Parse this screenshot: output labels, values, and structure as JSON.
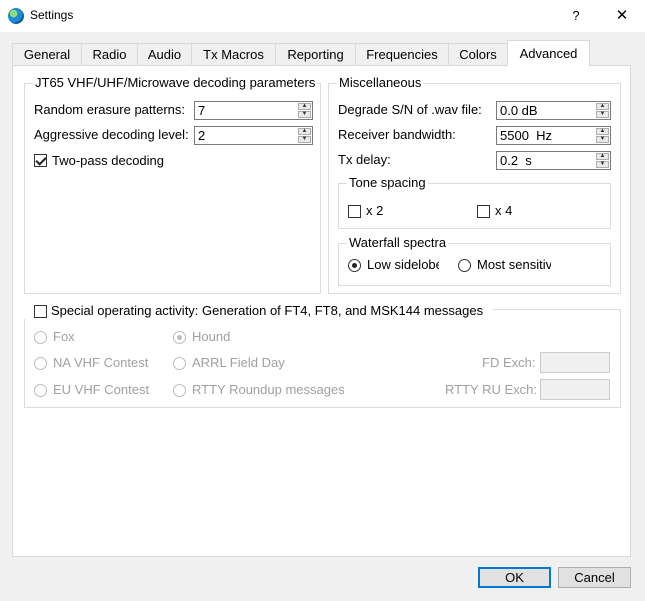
{
  "window": {
    "title": "Settings",
    "help_glyph": "?",
    "close_glyph": "✕"
  },
  "tabs": [
    {
      "label": "General"
    },
    {
      "label": "Radio"
    },
    {
      "label": "Audio"
    },
    {
      "label": "Tx Macros"
    },
    {
      "label": "Reporting"
    },
    {
      "label": "Frequencies"
    },
    {
      "label": "Colors"
    },
    {
      "label": "Advanced",
      "active": true
    }
  ],
  "jt65": {
    "title": "JT65 VHF/UHF/Microwave decoding parameters",
    "random_erasure_label": "Random erasure patterns:",
    "random_erasure_value": "7",
    "aggressive_label": "Aggressive decoding level:",
    "aggressive_value": "2",
    "two_pass_label": "Two-pass decoding",
    "two_pass_checked": true
  },
  "misc": {
    "title": "Miscellaneous",
    "degrade_label": "Degrade S/N of .wav file:",
    "degrade_value": "0.0 dB",
    "bandwidth_label": "Receiver bandwidth:",
    "bandwidth_value": "5500  Hz",
    "txdelay_label": "Tx delay:",
    "txdelay_value": "0.2  s",
    "tone_spacing": {
      "title": "Tone spacing",
      "x2_label": "x 2",
      "x4_label": "x 4"
    },
    "waterfall": {
      "title": "Waterfall spectra",
      "low_label": "Low sidelobes",
      "most_label": "Most sensitive",
      "selected": "low"
    }
  },
  "special": {
    "checkbox_label": "Special operating activity:  Generation of FT4, FT8, and MSK144 messages",
    "options": {
      "fox": "Fox",
      "hound": "Hound",
      "na_vhf": "NA VHF Contest",
      "arrl_fd": "ARRL Field Day",
      "eu_vhf": "EU VHF Contest",
      "rtty_ru": "RTTY Roundup messages"
    },
    "fd_exch_label": "FD Exch:",
    "rtty_exch_label": "RTTY RU Exch:",
    "fd_exch_value": "",
    "rtty_exch_value": ""
  },
  "buttons": {
    "ok": "OK",
    "cancel": "Cancel"
  },
  "colors": {
    "accent": "#0078d7",
    "disabled_text": "#a0a0a0"
  }
}
